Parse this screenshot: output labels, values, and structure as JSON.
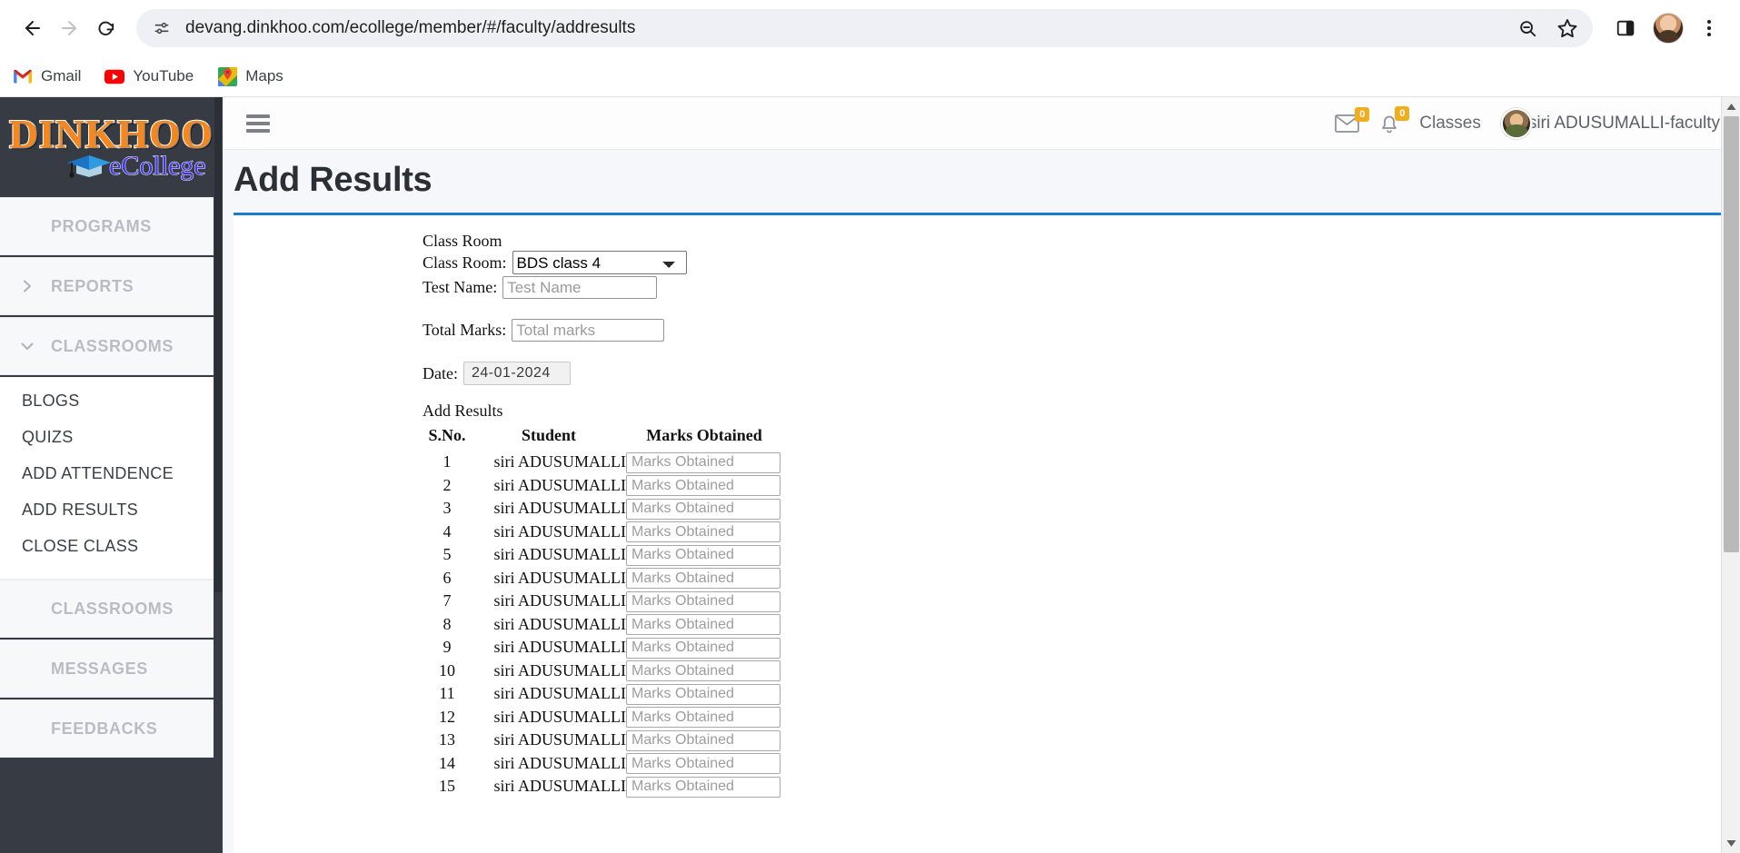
{
  "browser": {
    "back_icon": "back-arrow-icon",
    "forward_icon": "forward-arrow-icon",
    "reload_icon": "reload-icon",
    "site_info_icon": "site-settings-icon",
    "url": "devang.dinkhoo.com/ecollege/member/#/faculty/addresults",
    "zoom_out_icon": "zoom-out-icon",
    "bookmark_icon": "star-icon",
    "side_panel_icon": "side-panel-icon",
    "profile_icon": "profile-avatar-icon",
    "menu_icon": "three-dot-menu-icon",
    "bookmarks": [
      {
        "label": "Gmail",
        "icon": "gmail-icon"
      },
      {
        "label": "YouTube",
        "icon": "youtube-icon"
      },
      {
        "label": "Maps",
        "icon": "maps-icon"
      }
    ]
  },
  "sidebar": {
    "logo": {
      "word": "DINKHOO!",
      "sub": "eCollege",
      "cap_icon": "graduation-cap-icon"
    },
    "groups": [
      {
        "label": "PROGRAMS",
        "chevron": "none",
        "items": []
      },
      {
        "label": "REPORTS",
        "chevron": "right",
        "items": []
      },
      {
        "label": "CLASSROOMS",
        "chevron": "down",
        "items": [
          "BLOGS",
          "QUIZS",
          "ADD ATTENDENCE",
          "ADD RESULTS",
          "CLOSE CLASS"
        ]
      },
      {
        "label": "CLASSROOMS",
        "chevron": "none",
        "items": []
      },
      {
        "label": "MESSAGES",
        "chevron": "none",
        "items": []
      },
      {
        "label": "FEEDBACKS",
        "chevron": "none",
        "items": []
      }
    ]
  },
  "app_header": {
    "menu_toggle_icon": "hamburger-menu-icon",
    "mail_icon": "envelope-icon",
    "mail_badge": "0",
    "bell_icon": "bell-icon",
    "bell_badge": "0",
    "classes_link": "Classes",
    "user_name": "siri ADUSUMALLI-faculty",
    "user_avatar_icon": "user-avatar-icon"
  },
  "page": {
    "title": "Add Results",
    "accent_color": "#1a7bd4"
  },
  "form": {
    "section_label": "Class Room",
    "classroom_label": "Class Room:",
    "classroom_value": "BDS class 4",
    "classroom_options": [
      "BDS class 4"
    ],
    "testname_label": "Test Name:",
    "testname_value": "",
    "testname_placeholder": "Test Name",
    "totalmarks_label": "Total Marks:",
    "totalmarks_value": "",
    "totalmarks_placeholder": "Total marks",
    "date_label": "Date:",
    "date_value": "24-01-2024"
  },
  "results": {
    "sub_title": "Add Results",
    "columns": [
      "S.No.",
      "Student",
      "Marks Obtained"
    ],
    "marks_placeholder": "Marks Obtained",
    "rows": [
      {
        "sno": "1",
        "student": "siri ADUSUMALLI",
        "marks": ""
      },
      {
        "sno": "2",
        "student": "siri ADUSUMALLI",
        "marks": ""
      },
      {
        "sno": "3",
        "student": "siri ADUSUMALLI",
        "marks": ""
      },
      {
        "sno": "4",
        "student": "siri ADUSUMALLI",
        "marks": ""
      },
      {
        "sno": "5",
        "student": "siri ADUSUMALLI",
        "marks": ""
      },
      {
        "sno": "6",
        "student": "siri ADUSUMALLI",
        "marks": ""
      },
      {
        "sno": "7",
        "student": "siri ADUSUMALLI",
        "marks": ""
      },
      {
        "sno": "8",
        "student": "siri ADUSUMALLI",
        "marks": ""
      },
      {
        "sno": "9",
        "student": "siri ADUSUMALLI",
        "marks": ""
      },
      {
        "sno": "10",
        "student": "siri ADUSUMALLI",
        "marks": ""
      },
      {
        "sno": "11",
        "student": "siri ADUSUMALLI",
        "marks": ""
      },
      {
        "sno": "12",
        "student": "siri ADUSUMALLI",
        "marks": ""
      },
      {
        "sno": "13",
        "student": "siri ADUSUMALLI",
        "marks": ""
      },
      {
        "sno": "14",
        "student": "siri ADUSUMALLI",
        "marks": ""
      },
      {
        "sno": "15",
        "student": "siri ADUSUMALLI",
        "marks": ""
      }
    ]
  }
}
